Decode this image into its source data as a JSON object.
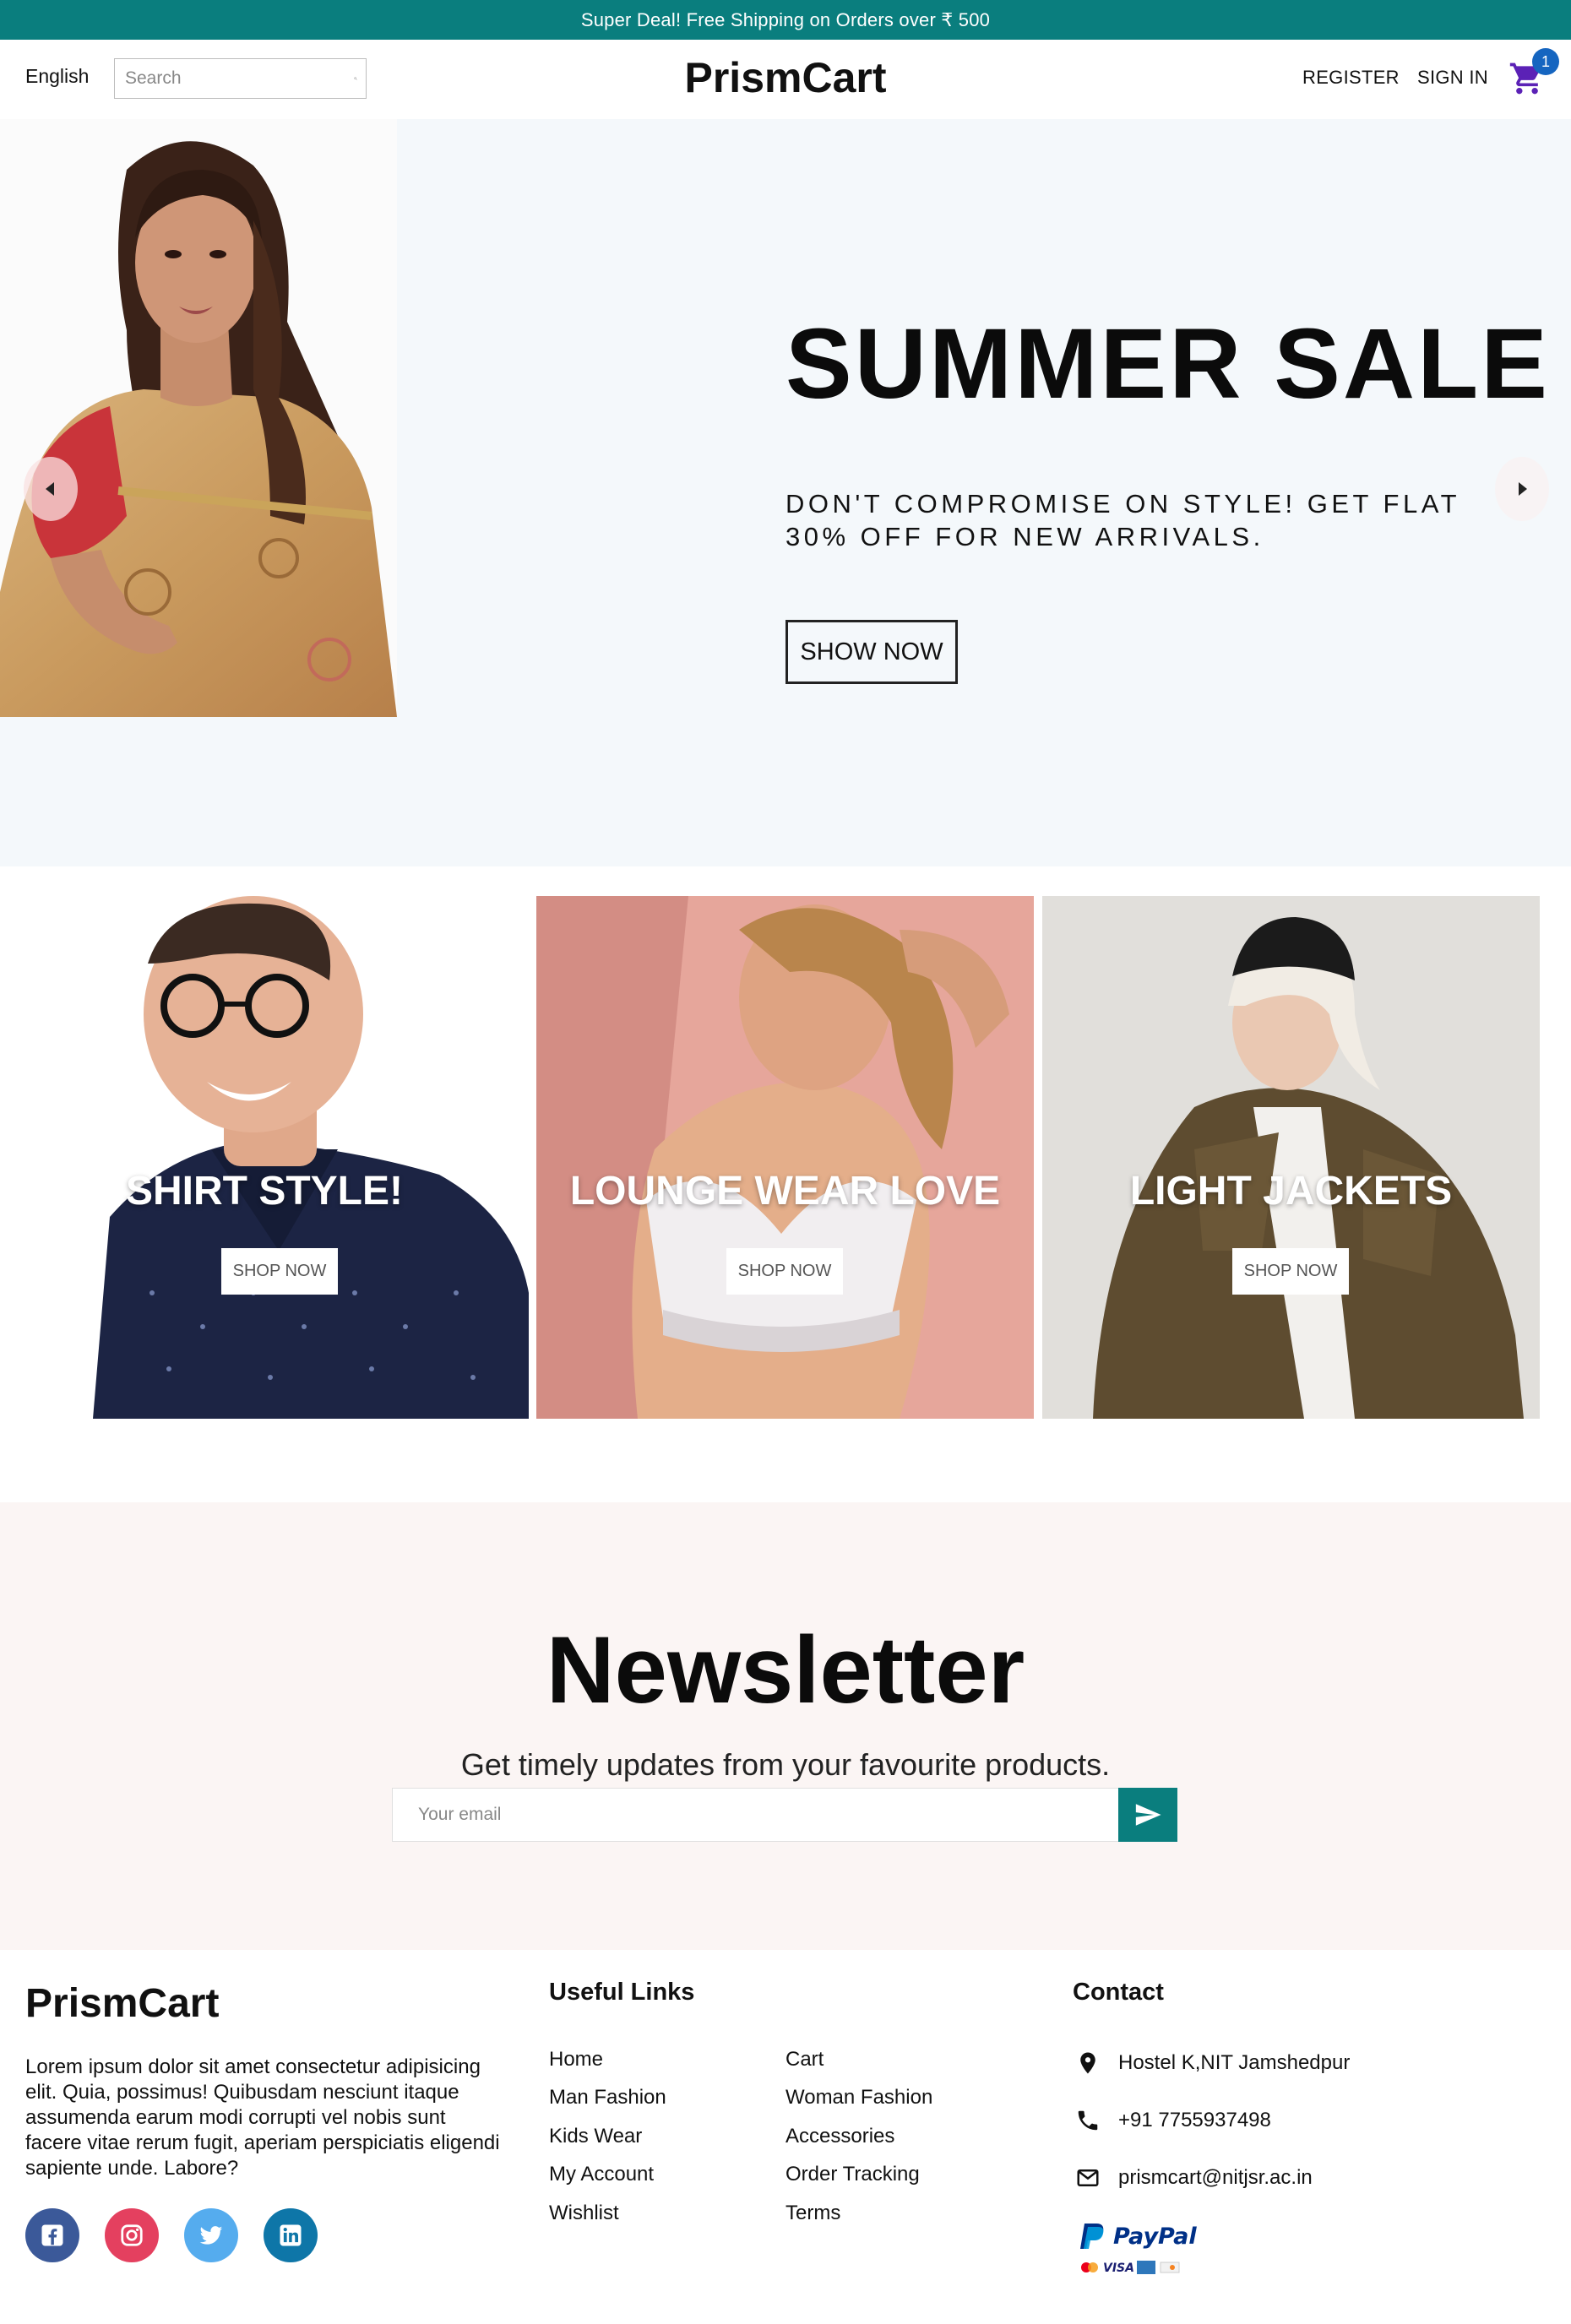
{
  "announcement": "Super Deal! Free Shipping on Orders over ₹ 500",
  "nav": {
    "language": "English",
    "search_placeholder": "Search",
    "logo": "PrismCart",
    "register": "REGISTER",
    "sign_in": "SIGN IN",
    "cart_count": "1"
  },
  "hero": {
    "title": "SUMMER SALE",
    "description": "DON'T COMPROMISE ON STYLE! GET FLAT 30% OFF FOR NEW ARRIVALS.",
    "button": "SHOW NOW"
  },
  "categories": [
    {
      "title": "SHIRT STYLE!",
      "button": "SHOP NOW"
    },
    {
      "title": "LOUNGE WEAR LOVE",
      "button": "SHOP NOW"
    },
    {
      "title": "LIGHT JACKETS",
      "button": "SHOP NOW"
    }
  ],
  "newsletter": {
    "title": "Newsletter",
    "subtitle": "Get timely updates from your favourite products.",
    "email_placeholder": "Your email"
  },
  "footer": {
    "logo": "PrismCart",
    "description": "Lorem ipsum dolor sit amet consectetur adipisicing elit. Quia, possimus! Quibusdam nesciunt itaque assumenda earum modi corrupti vel nobis sunt facere vitae rerum fugit, aperiam perspiciatis eligendi sapiente unde. Labore?",
    "useful_links_heading": "Useful Links",
    "links_col1": [
      "Home",
      "Man Fashion",
      "Kids Wear",
      "My Account",
      "Wishlist"
    ],
    "links_col2": [
      "Cart",
      "Woman Fashion",
      "Accessories",
      "Order Tracking",
      "Terms"
    ],
    "contact_heading": "Contact",
    "address": "Hostel K,NIT Jamshedpur",
    "phone": "+91 7755937498",
    "email": "prismcart@nitjsr.ac.in",
    "payment_logo": "PayPal"
  },
  "colors": {
    "brand_teal": "#0a7e7e",
    "cart_purple": "#5b21b6",
    "badge_blue": "#1565c0",
    "hero_bg": "#f4f8fb",
    "newsletter_bg": "#fbf5f4",
    "facebook": "#3b5999",
    "instagram": "#e4405f",
    "twitter": "#55acee",
    "linkedin": "#0e76a8"
  }
}
